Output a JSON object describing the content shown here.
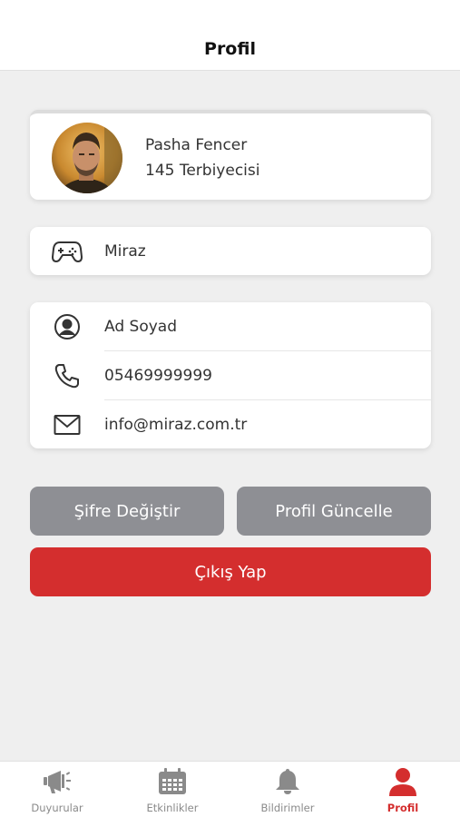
{
  "header": {
    "title": "Profil"
  },
  "profile": {
    "name": "Pasha Fencer",
    "role": "145 Terbiyecisi"
  },
  "game": {
    "icon": "gamepad-icon",
    "label": "Miraz"
  },
  "contact": {
    "items": [
      {
        "icon": "user-circle-icon",
        "label": "Ad Soyad"
      },
      {
        "icon": "phone-icon",
        "label": "05469999999"
      },
      {
        "icon": "mail-icon",
        "label": "info@miraz.com.tr"
      }
    ]
  },
  "actions": {
    "change_password": "Şifre Değiştir",
    "update_profile": "Profil Güncelle",
    "logout": "Çıkış Yap"
  },
  "tabbar": {
    "tabs": [
      {
        "icon": "megaphone-icon",
        "label": "Duyurular"
      },
      {
        "icon": "calendar-icon",
        "label": "Etkinlikler"
      },
      {
        "icon": "bell-icon",
        "label": "Bildirimler"
      },
      {
        "icon": "person-icon",
        "label": "Profil"
      }
    ]
  },
  "colors": {
    "accent": "#d42e2e",
    "button_gray": "#8e8f94",
    "background": "#efefef"
  }
}
